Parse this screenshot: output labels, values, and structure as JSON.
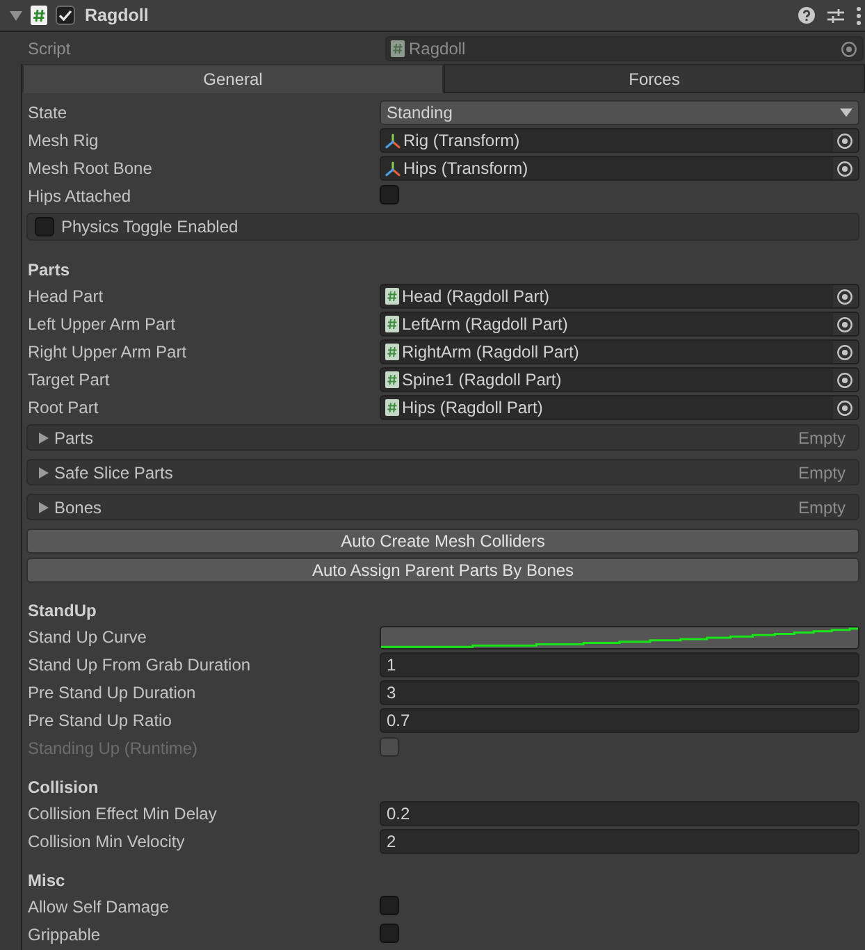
{
  "component": {
    "title": "Ragdoll",
    "expanded": true,
    "enabled": true
  },
  "script": {
    "label": "Script",
    "value": "Ragdoll",
    "disabled": true
  },
  "tabs": [
    {
      "label": "General",
      "selected": true
    },
    {
      "label": "Forces",
      "selected": false
    }
  ],
  "rows": [
    {
      "kind": "dropdown",
      "label": "State",
      "value": "Standing"
    },
    {
      "kind": "transform",
      "label": "Mesh Rig",
      "value": "Rig (Transform)"
    },
    {
      "kind": "transform",
      "label": "Mesh Root Bone",
      "value": "Hips (Transform)"
    },
    {
      "kind": "checkbox",
      "label": "Hips Attached",
      "checked": false,
      "disabled": false
    },
    {
      "kind": "toggle_box",
      "label": "Physics Toggle Enabled",
      "checked": false
    },
    {
      "kind": "header",
      "label": "Parts"
    },
    {
      "kind": "component",
      "label": "Head Part",
      "value": "Head (Ragdoll Part)"
    },
    {
      "kind": "component",
      "label": "Left Upper Arm Part",
      "value": "LeftArm (Ragdoll Part)"
    },
    {
      "kind": "component",
      "label": "Right Upper Arm Part",
      "value": "RightArm (Ragdoll Part)"
    },
    {
      "kind": "component",
      "label": "Target Part",
      "value": "Spine1 (Ragdoll Part)"
    },
    {
      "kind": "component",
      "label": "Root Part",
      "value": "Hips (Ragdoll Part)"
    },
    {
      "kind": "foldout",
      "label": "Parts",
      "summary": "Empty",
      "expanded": false
    },
    {
      "kind": "foldout",
      "label": "Safe Slice Parts",
      "summary": "Empty",
      "expanded": false
    },
    {
      "kind": "foldout",
      "label": "Bones",
      "summary": "Empty",
      "expanded": false
    },
    {
      "kind": "button",
      "label": "Auto Create Mesh Colliders"
    },
    {
      "kind": "button",
      "label": "Auto Assign Parent Parts By Bones"
    },
    {
      "kind": "header",
      "label": "StandUp"
    },
    {
      "kind": "curve",
      "label": "Stand Up Curve"
    },
    {
      "kind": "number",
      "label": "Stand Up From Grab Duration",
      "value": "1"
    },
    {
      "kind": "number",
      "label": "Pre Stand Up Duration",
      "value": "3"
    },
    {
      "kind": "number",
      "label": "Pre Stand Up Ratio",
      "value": "0.7"
    },
    {
      "kind": "checkbox",
      "label": "Standing Up (Runtime)",
      "checked": false,
      "disabled": true
    },
    {
      "kind": "header",
      "label": "Collision"
    },
    {
      "kind": "number",
      "label": "Collision Effect Min Delay",
      "value": "0.2"
    },
    {
      "kind": "number",
      "label": "Collision Min Velocity",
      "value": "2"
    },
    {
      "kind": "header",
      "label": "Misc"
    },
    {
      "kind": "checkbox",
      "label": "Allow Self Damage",
      "checked": false,
      "disabled": false
    },
    {
      "kind": "checkbox",
      "label": "Grippable",
      "checked": false,
      "disabled": false
    }
  ]
}
